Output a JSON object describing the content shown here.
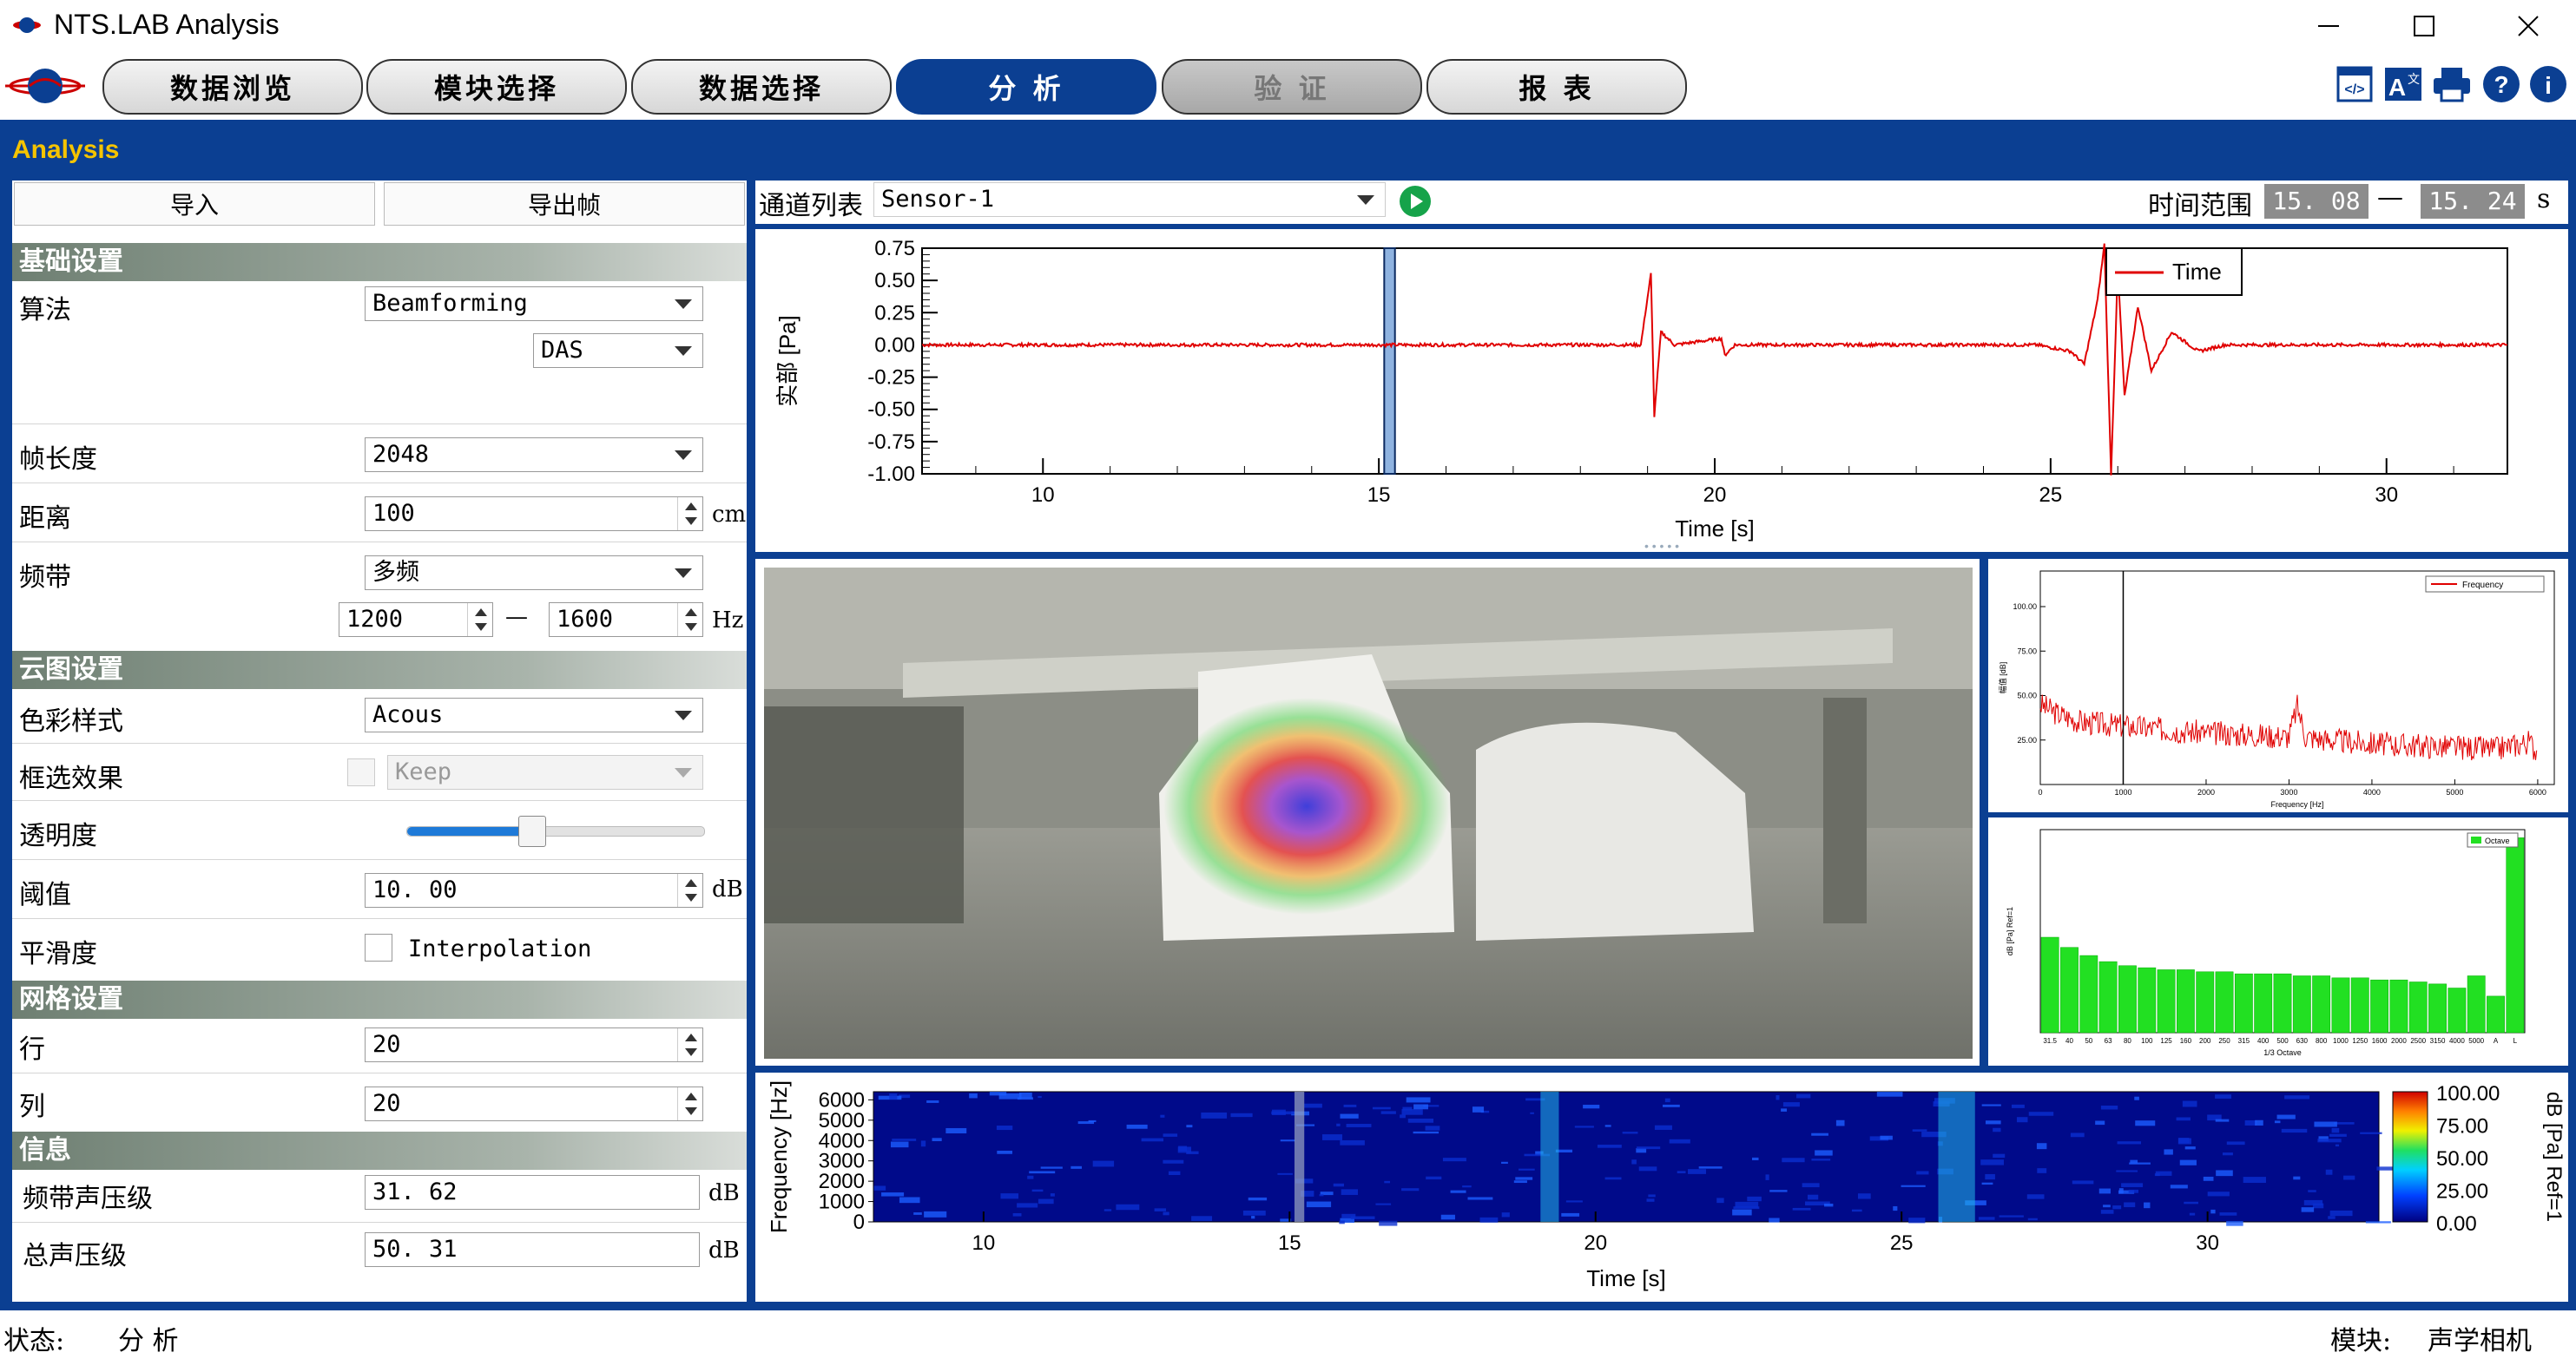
{
  "window": {
    "title": "NTS.LAB Analysis"
  },
  "tabs": [
    {
      "label": "数据浏览",
      "state": "normal"
    },
    {
      "label": "模块选择",
      "state": "normal"
    },
    {
      "label": "数据选择",
      "state": "normal"
    },
    {
      "label": "分 析",
      "state": "active"
    },
    {
      "label": "验 证",
      "state": "disabled"
    },
    {
      "label": "报 表",
      "state": "normal"
    }
  ],
  "toolbar_icons": [
    "code-view-icon",
    "translate-icon",
    "print-icon",
    "help-icon",
    "info-icon"
  ],
  "band_title": "Analysis",
  "left": {
    "import_label": "导入",
    "export_label": "导出帧",
    "basic": {
      "title": "基础设置",
      "algo_label": "算法",
      "algo_value": "Beamforming",
      "algo_sub_value": "DAS",
      "frame_label": "帧长度",
      "frame_value": "2048",
      "distance_label": "距离",
      "distance_value": "100",
      "distance_unit": "cm",
      "band_label": "频带",
      "band_value": "多频",
      "band_low": "1200",
      "band_dash": "—",
      "band_high": "1600",
      "band_unit": "Hz"
    },
    "cloud": {
      "title": "云图设置",
      "color_label": "色彩样式",
      "color_value": "Acous",
      "box_label": "框选效果",
      "box_value": "Keep",
      "opacity_label": "透明度",
      "opacity_value": 0.42,
      "threshold_label": "阈值",
      "threshold_value": "10. 00",
      "threshold_unit": "dB",
      "smooth_label": "平滑度",
      "smooth_option": "Interpolation"
    },
    "grid": {
      "title": "网格设置",
      "row_label": "行",
      "row_value": "20",
      "col_label": "列",
      "col_value": "20"
    },
    "info": {
      "title": "信息",
      "band_spl_label": "频带声压级",
      "band_spl_value": "31. 62",
      "band_spl_unit": "dB",
      "total_spl_label": "总声压级",
      "total_spl_value": "50. 31",
      "total_spl_unit": "dB"
    }
  },
  "toolbar": {
    "channel_label": "通道列表",
    "channel_value": "Sensor-1",
    "time_range_label": "时间范围",
    "time_start": "15. 08",
    "time_dash": "—",
    "time_end": "15. 24",
    "time_unit": "s"
  },
  "status": {
    "left_label": "状态:",
    "left_value": "分 析",
    "right_label": "模块:",
    "right_value": "声学相机"
  },
  "colors": {
    "brand_blue": "#0b3f92",
    "signal_red": "#e00000",
    "bar_green": "#22e022",
    "accent_yellow": "#f5c400"
  },
  "chart_data": [
    {
      "type": "line",
      "xlabel": "Time [s]",
      "ylabel": "实部 [Pa]",
      "xlim": [
        8.2,
        31.8
      ],
      "ylim": [
        -1.0,
        0.75
      ],
      "x_ticks": [
        "10",
        "15",
        "20",
        "25",
        "30"
      ],
      "y_ticks": [
        "0.75",
        "0.50",
        "0.25",
        "0.00",
        "-0.25",
        "-0.50",
        "-0.75",
        "-1.00"
      ],
      "legend": "top-right",
      "series": [
        {
          "name": "Time",
          "points": [
            [
              8.2,
              0.0
            ],
            [
              12.0,
              0.0
            ],
            [
              15.0,
              0.0
            ],
            [
              18.9,
              0.0
            ],
            [
              19.05,
              0.55
            ],
            [
              19.1,
              -0.55
            ],
            [
              19.2,
              0.1
            ],
            [
              19.4,
              0.0
            ],
            [
              20.1,
              0.05
            ],
            [
              20.15,
              -0.08
            ],
            [
              20.3,
              0.0
            ],
            [
              24.8,
              0.0
            ],
            [
              25.3,
              -0.05
            ],
            [
              25.5,
              -0.15
            ],
            [
              25.7,
              0.35
            ],
            [
              25.8,
              0.78
            ],
            [
              25.9,
              -1.0
            ],
            [
              26.0,
              0.6
            ],
            [
              26.1,
              -0.4
            ],
            [
              26.3,
              0.3
            ],
            [
              26.5,
              -0.2
            ],
            [
              26.8,
              0.1
            ],
            [
              27.2,
              -0.05
            ],
            [
              27.6,
              0.0
            ],
            [
              31.8,
              0.0
            ]
          ]
        }
      ],
      "selection": [
        15.08,
        15.24
      ]
    },
    {
      "type": "line",
      "xlabel": "Frequency [Hz]",
      "ylabel": "幅值 [dB]",
      "xlim": [
        0,
        6200
      ],
      "ylim": [
        0,
        120
      ],
      "x_ticks": [
        "0",
        "1000",
        "2000",
        "3000",
        "4000",
        "5000",
        "6000"
      ],
      "y_ticks": [
        "100.00",
        "75.00",
        "50.00",
        "25.00"
      ],
      "legend": "top-right",
      "series": [
        {
          "name": "Frequency",
          "points": [
            [
              0,
              45
            ],
            [
              200,
              40
            ],
            [
              500,
              35
            ],
            [
              1000,
              33
            ],
            [
              1500,
              31
            ],
            [
              2000,
              29
            ],
            [
              2500,
              28
            ],
            [
              3000,
              27
            ],
            [
              3100,
              44
            ],
            [
              3200,
              27
            ],
            [
              3500,
              25
            ],
            [
              4000,
              23
            ],
            [
              4500,
              22
            ],
            [
              5000,
              21
            ],
            [
              5500,
              20
            ],
            [
              5900,
              24
            ],
            [
              6000,
              18
            ]
          ]
        }
      ],
      "marker_x": 1000
    },
    {
      "type": "bar",
      "xlabel": "1/3 Octave",
      "ylabel": "dB [Pa] Ref=1",
      "ylim": [
        0,
        100
      ],
      "legend": "top-right",
      "categories": [
        "31.5",
        "40",
        "50",
        "63",
        "80",
        "100",
        "125",
        "160",
        "200",
        "250",
        "315",
        "400",
        "500",
        "630",
        "800",
        "1000",
        "1250",
        "1600",
        "2000",
        "2500",
        "3150",
        "4000",
        "5000",
        "A",
        "L"
      ],
      "series": [
        {
          "name": "Octave",
          "values": [
            47,
            42,
            38,
            35,
            33,
            32,
            31,
            31,
            30,
            30,
            29,
            29,
            29,
            28,
            28,
            27,
            27,
            26,
            26,
            25,
            24,
            22,
            28,
            18,
            96
          ]
        }
      ]
    },
    {
      "type": "heatmap",
      "xlabel": "Time [s]",
      "ylabel": "Frequency [Hz]",
      "xlim": [
        8.2,
        32.8
      ],
      "ylim": [
        0,
        6400
      ],
      "x_ticks": [
        "10",
        "15",
        "20",
        "25",
        "30"
      ],
      "y_ticks": [
        "6000",
        "5000",
        "4000",
        "3000",
        "2000",
        "1000",
        "0"
      ],
      "colorbar_label": "dB [Pa] Ref=1",
      "colorbar_ticks": [
        "100.00",
        "75.00",
        "50.00",
        "25.00",
        "0.00"
      ],
      "hot_bands": [
        [
          19.1,
          19.4
        ],
        [
          25.6,
          26.2
        ]
      ]
    }
  ]
}
